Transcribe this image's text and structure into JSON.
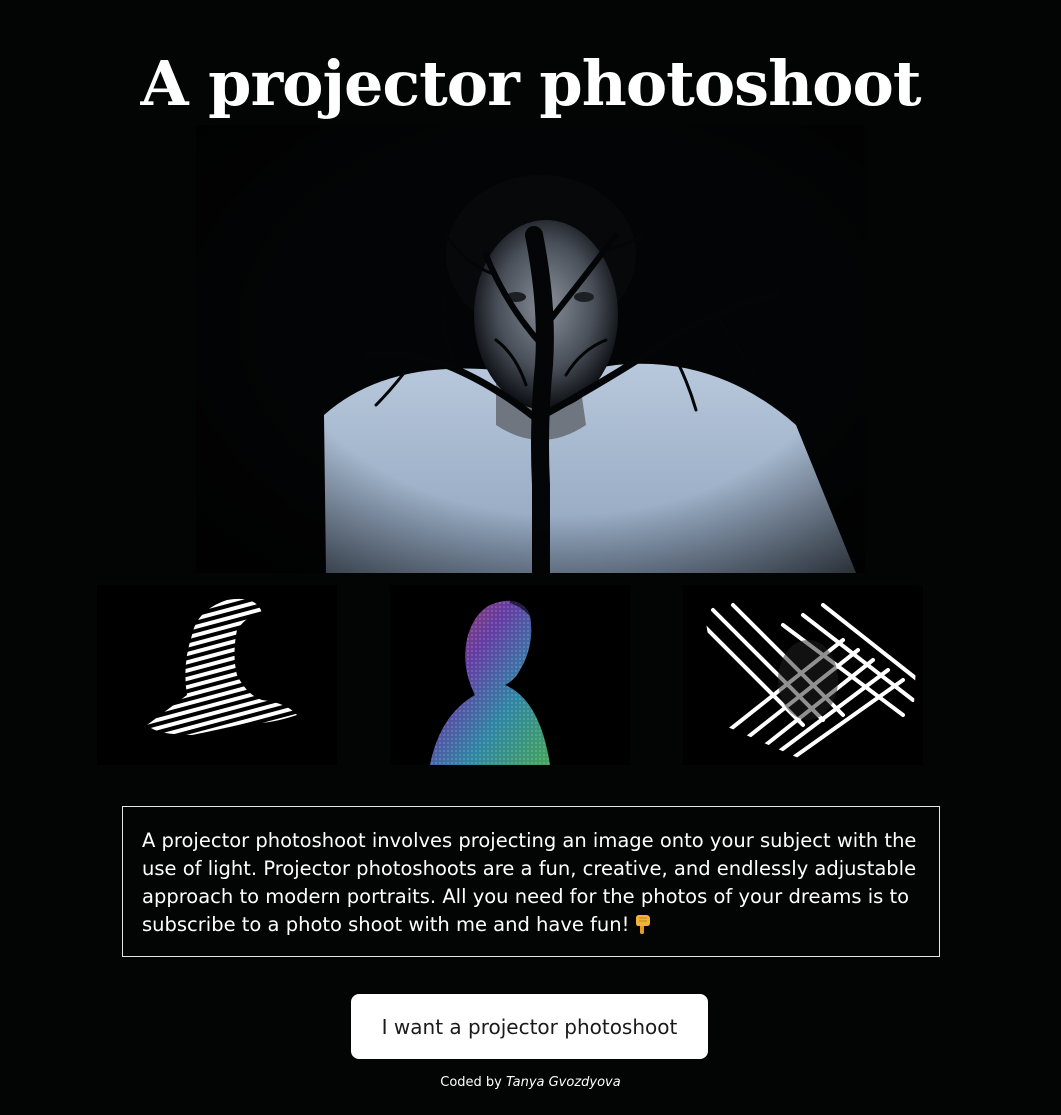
{
  "page": {
    "title": "A projector photoshoot"
  },
  "gallery": {
    "hero_alt": "Portrait with tree branch shadow projection",
    "thumbs": [
      {
        "alt": "Figure with black and white stripe projection"
      },
      {
        "alt": "Portrait with colorful light projection"
      },
      {
        "alt": "Figure under diagonal stripe projection"
      }
    ]
  },
  "description": {
    "text": "A projector photoshoot involves projecting an image onto your subject with the use of light. Projector photoshoots are a fun, creative, and endlessly adjustable approach to modern portraits. All you need for the photos of your dreams is to subscribe to a photo shoot with me and have fun!",
    "emoji_icon": "pointing-down-hand-icon"
  },
  "cta": {
    "label": "I want a projector photoshoot"
  },
  "footer": {
    "prefix": "Coded by",
    "author": "Tanya Gvozdyova"
  },
  "colors": {
    "background": "#020503",
    "text": "#ffffff",
    "button_bg": "#ffffff",
    "button_text": "#1a1a1a",
    "border": "#e6e6e6"
  }
}
